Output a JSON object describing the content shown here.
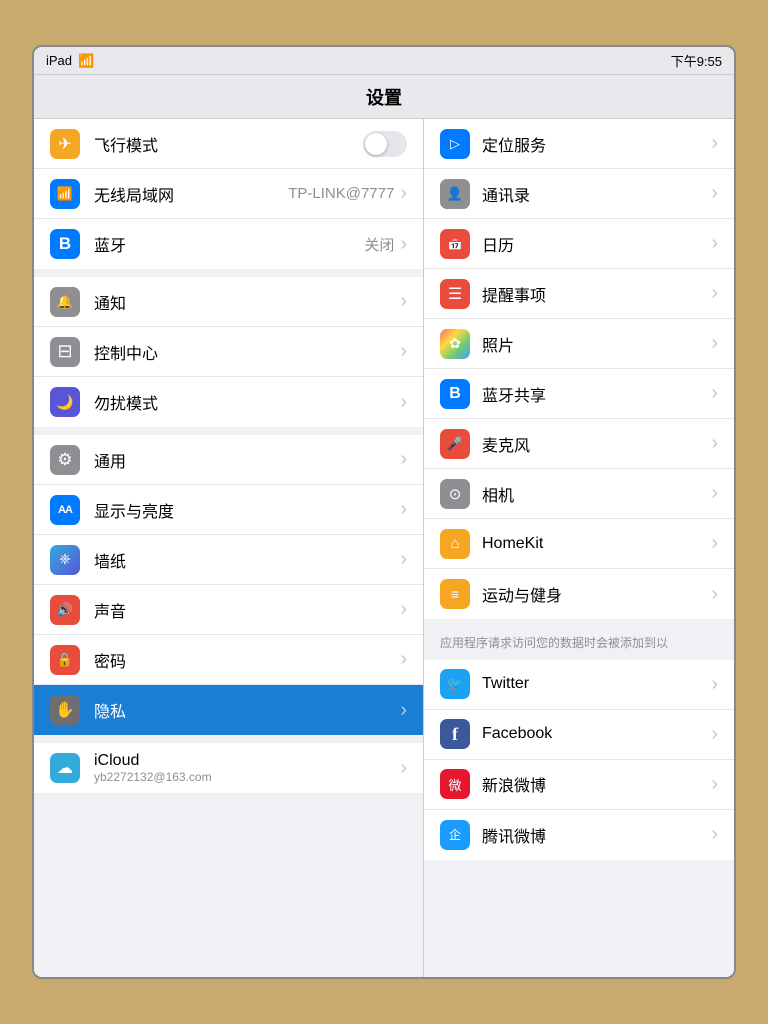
{
  "statusBar": {
    "device": "iPad",
    "wifi": "WiFi",
    "time": "下午9:55"
  },
  "titleBar": {
    "title": "设置"
  },
  "leftPanel": {
    "sections": [
      {
        "id": "network",
        "rows": [
          {
            "id": "airplane",
            "label": "飞行模式",
            "iconClass": "ic-airplane icon-airplane",
            "control": "toggle"
          },
          {
            "id": "wifi",
            "label": "无线局域网",
            "iconClass": "ic-wifi",
            "iconText": "WiFi",
            "value": "TP-LINK@7777",
            "control": "chevron"
          },
          {
            "id": "bluetooth",
            "label": "蓝牙",
            "iconClass": "ic-bluetooth",
            "iconText": "BT",
            "value": "关闭",
            "control": "chevron"
          }
        ]
      },
      {
        "id": "system",
        "rows": [
          {
            "id": "notification",
            "label": "通知",
            "iconClass": "ic-notification",
            "iconText": "🔔",
            "control": "chevron"
          },
          {
            "id": "control",
            "label": "控制中心",
            "iconClass": "ic-control",
            "iconText": "⊟",
            "control": "chevron"
          },
          {
            "id": "dnd",
            "label": "勿扰模式",
            "iconClass": "ic-dnd",
            "iconText": "🌙",
            "control": "chevron"
          }
        ]
      },
      {
        "id": "personalize",
        "rows": [
          {
            "id": "general",
            "label": "通用",
            "iconClass": "ic-general",
            "iconText": "⚙",
            "control": "chevron"
          },
          {
            "id": "display",
            "label": "显示与亮度",
            "iconClass": "ic-display",
            "iconText": "AA",
            "control": "chevron"
          },
          {
            "id": "wallpaper",
            "label": "墙纸",
            "iconClass": "ic-wallpaper",
            "iconText": "❀",
            "control": "chevron"
          },
          {
            "id": "sound",
            "label": "声音",
            "iconClass": "ic-sound",
            "iconText": "🔊",
            "control": "chevron"
          },
          {
            "id": "passcode",
            "label": "密码",
            "iconClass": "ic-passcode",
            "iconText": "🔒",
            "control": "chevron"
          },
          {
            "id": "privacy",
            "label": "隐私",
            "iconClass": "ic-privacy",
            "iconText": "✋",
            "control": "chevron",
            "selected": true
          }
        ]
      },
      {
        "id": "account",
        "rows": [
          {
            "id": "icloud",
            "label": "iCloud",
            "iconClass": "ic-icloud",
            "iconText": "☁",
            "subLabel": "yb2272132@163.com",
            "control": "chevron"
          }
        ]
      }
    ]
  },
  "rightPanel": {
    "sections": [
      {
        "id": "privacy-items",
        "rows": [
          {
            "id": "location",
            "label": "定位服务",
            "iconClass": "ic-location",
            "iconText": "▷"
          },
          {
            "id": "contacts",
            "label": "通讯录",
            "iconClass": "ic-contacts",
            "iconText": "👤"
          },
          {
            "id": "calendar",
            "label": "日历",
            "iconClass": "ic-calendar",
            "iconText": "31"
          },
          {
            "id": "reminders",
            "label": "提醒事项",
            "iconClass": "ic-reminders",
            "iconText": "≡"
          },
          {
            "id": "photos",
            "label": "照片",
            "iconClass": "ic-photos",
            "iconText": "✿"
          },
          {
            "id": "bt-share",
            "label": "蓝牙共享",
            "iconClass": "ic-bt-share",
            "iconText": "⁕"
          },
          {
            "id": "microphone",
            "label": "麦克风",
            "iconClass": "ic-microphone",
            "iconText": "🎤"
          },
          {
            "id": "camera",
            "label": "相机",
            "iconClass": "ic-camera",
            "iconText": "⊙"
          },
          {
            "id": "homekit",
            "label": "HomeKit",
            "iconClass": "ic-homekit",
            "iconText": "⌂"
          },
          {
            "id": "health",
            "label": "运动与健身",
            "iconClass": "ic-health",
            "iconText": "≡"
          }
        ]
      },
      {
        "id": "notice",
        "noticeText": "应用程序请求访问您的数据时会被添加到以"
      },
      {
        "id": "social-items",
        "rows": [
          {
            "id": "twitter",
            "label": "Twitter",
            "iconClass": "ic-twitter",
            "iconText": "🐦"
          },
          {
            "id": "facebook",
            "label": "Facebook",
            "iconClass": "ic-facebook",
            "iconText": "f"
          },
          {
            "id": "sina-weibo",
            "label": "新浪微博",
            "iconClass": "ic-weibo",
            "iconText": "W"
          },
          {
            "id": "tencent-weibo",
            "label": "腾讯微博",
            "iconClass": "ic-tencent",
            "iconText": "企"
          }
        ]
      }
    ]
  }
}
